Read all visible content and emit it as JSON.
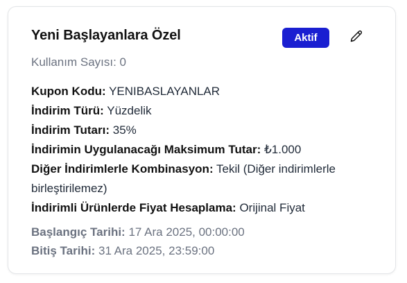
{
  "coupon": {
    "title": "Yeni Başlayanlara Özel",
    "status_badge": "Aktif",
    "usage_text": "Kullanım Sayısı: 0",
    "details": [
      {
        "label": "Kupon Kodu:",
        "value": "YENIBASLAYANLAR"
      },
      {
        "label": "İndirim Türü:",
        "value": "Yüzdelik"
      },
      {
        "label": "İndirim Tutarı:",
        "value": "35%"
      },
      {
        "label": "İndirimin Uygulanacağı Maksimum Tutar:",
        "value": "₺1.000"
      },
      {
        "label": "Diğer İndirimlerle Kombinasyon:",
        "value": "Tekil (Diğer indirimlerle birleştirilemez)"
      },
      {
        "label": "İndirimli Ürünlerde Fiyat Hesaplama:",
        "value": "Orijinal Fiyat"
      }
    ],
    "start_date": {
      "label": "Başlangıç Tarihi:",
      "value": "17 Ara 2025, 00:00:00"
    },
    "end_date": {
      "label": "Bitiş Tarihi:",
      "value": "31 Ara 2025, 23:59:00"
    }
  },
  "icons": {
    "edit": "pencil-icon"
  },
  "colors": {
    "badge_bg": "#1a1fd1",
    "muted_text": "#6b7280"
  }
}
